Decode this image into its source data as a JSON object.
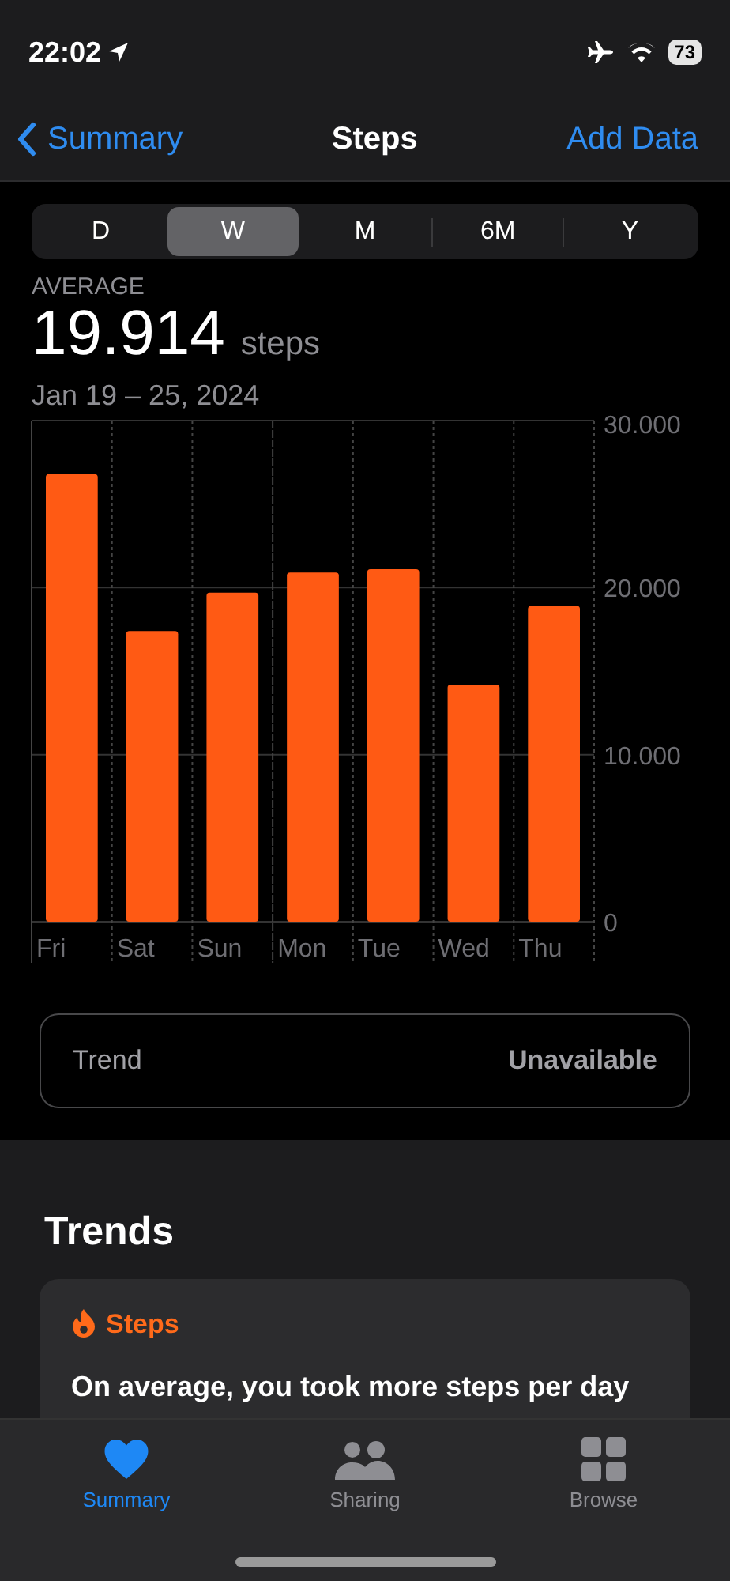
{
  "status_bar": {
    "time": "22:02",
    "battery": "73"
  },
  "nav": {
    "back": "Summary",
    "title": "Steps",
    "action": "Add Data"
  },
  "ranges": [
    {
      "label": "D",
      "selected": false
    },
    {
      "label": "W",
      "selected": true
    },
    {
      "label": "M",
      "selected": false
    },
    {
      "label": "6M",
      "selected": false
    },
    {
      "label": "Y",
      "selected": false
    }
  ],
  "summary": {
    "label": "AVERAGE",
    "value": "19.914",
    "unit": "steps",
    "date_range": "Jan 19 – 25, 2024"
  },
  "chart_data": {
    "type": "bar",
    "categories": [
      "Fri",
      "Sat",
      "Sun",
      "Mon",
      "Tue",
      "Wed",
      "Thu"
    ],
    "values": [
      26800,
      17400,
      19700,
      20900,
      21100,
      14200,
      18900
    ],
    "ylim": [
      0,
      30000
    ],
    "yticks": [
      {
        "value": 0,
        "label": "0"
      },
      {
        "value": 10000,
        "label": "10.000"
      },
      {
        "value": 20000,
        "label": "20.000"
      },
      {
        "value": 30000,
        "label": "30.000"
      }
    ]
  },
  "trend": {
    "label": "Trend",
    "value": "Unavailable"
  },
  "trends_section": {
    "title": "Trends",
    "card_title": "Steps",
    "card_text": "On average, you took more steps per day"
  },
  "tab_bar": [
    {
      "label": "Summary",
      "selected": true
    },
    {
      "label": "Sharing",
      "selected": false
    },
    {
      "label": "Browse",
      "selected": false
    }
  ]
}
